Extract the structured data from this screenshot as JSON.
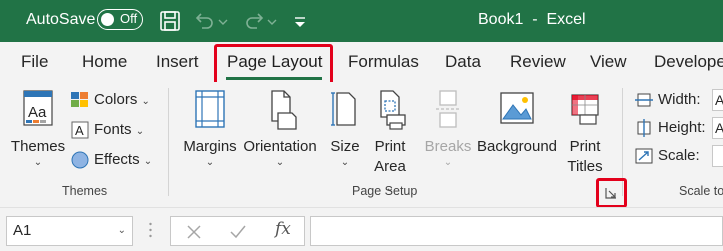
{
  "titlebar": {
    "autosave_label": "AutoSave",
    "autosave_state": "Off",
    "document_title": "Book1  -  Excel",
    "icons": [
      "save-icon",
      "undo-icon",
      "redo-icon",
      "customize-quick-access-icon"
    ],
    "bg_color": "#217346"
  },
  "tabs": [
    {
      "label": "File"
    },
    {
      "label": "Home"
    },
    {
      "label": "Insert"
    },
    {
      "label": "Page Layout",
      "active": true
    },
    {
      "label": "Formulas"
    },
    {
      "label": "Data"
    },
    {
      "label": "Review"
    },
    {
      "label": "View"
    },
    {
      "label": "Develope"
    }
  ],
  "highlight_color": "#e3001b",
  "ribbon": {
    "themes_group": {
      "label": "Themes",
      "themes_button": "Themes",
      "colors": "Colors",
      "fonts": "Fonts",
      "effects": "Effects"
    },
    "page_setup_group": {
      "label": "Page Setup",
      "margins": "Margins",
      "orientation": "Orientation",
      "size": "Size",
      "print_area_line1": "Print",
      "print_area_line2": "Area",
      "breaks": "Breaks",
      "background": "Background",
      "print_titles_line1": "Print",
      "print_titles_line2": "Titles"
    },
    "scale_group": {
      "label": "Scale to",
      "width": "Width:",
      "height": "Height:",
      "scale": "Scale:",
      "width_value": "A",
      "height_value": "A"
    }
  },
  "formula_bar": {
    "name_box": "A1",
    "fx": "fx",
    "formula": ""
  }
}
